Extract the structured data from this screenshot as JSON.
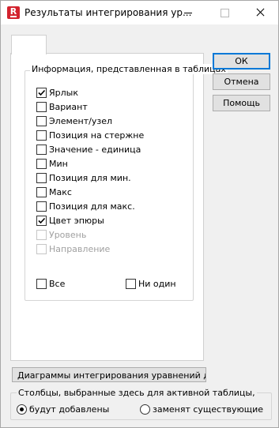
{
  "window": {
    "title": "Результаты интегрирования ур..."
  },
  "group": {
    "title": "Информация, представленная в таблицах"
  },
  "columns": [
    {
      "label": "Ярлык",
      "checked": true,
      "enabled": true
    },
    {
      "label": "Вариант",
      "checked": false,
      "enabled": true
    },
    {
      "label": "Элемент/узел",
      "checked": false,
      "enabled": true
    },
    {
      "label": "Позиция на стержне",
      "checked": false,
      "enabled": true
    },
    {
      "label": "Значение - единица",
      "checked": false,
      "enabled": true
    },
    {
      "label": "Мин",
      "checked": false,
      "enabled": true
    },
    {
      "label": "Позиция для мин.",
      "checked": false,
      "enabled": true
    },
    {
      "label": "Макс",
      "checked": false,
      "enabled": true
    },
    {
      "label": "Позиция для макс.",
      "checked": false,
      "enabled": true
    },
    {
      "label": "Цвет эпюры",
      "checked": true,
      "enabled": true
    },
    {
      "label": "Уровень",
      "checked": false,
      "enabled": false
    },
    {
      "label": "Направление",
      "checked": false,
      "enabled": false
    }
  ],
  "select_all": {
    "label": "Все",
    "checked": false
  },
  "select_none": {
    "label": "Ни один",
    "checked": false
  },
  "buttons": {
    "ok": "ОК",
    "cancel": "Отмена",
    "help": "Помощь"
  },
  "diagram_button": {
    "label": "Диаграммы интегрирования уравнений движения"
  },
  "apply_group": {
    "title": "Столбцы, выбранные здесь для активной таблицы,",
    "options": [
      {
        "label": "будут добавлены",
        "selected": true
      },
      {
        "label": "заменят существующие",
        "selected": false
      }
    ]
  }
}
